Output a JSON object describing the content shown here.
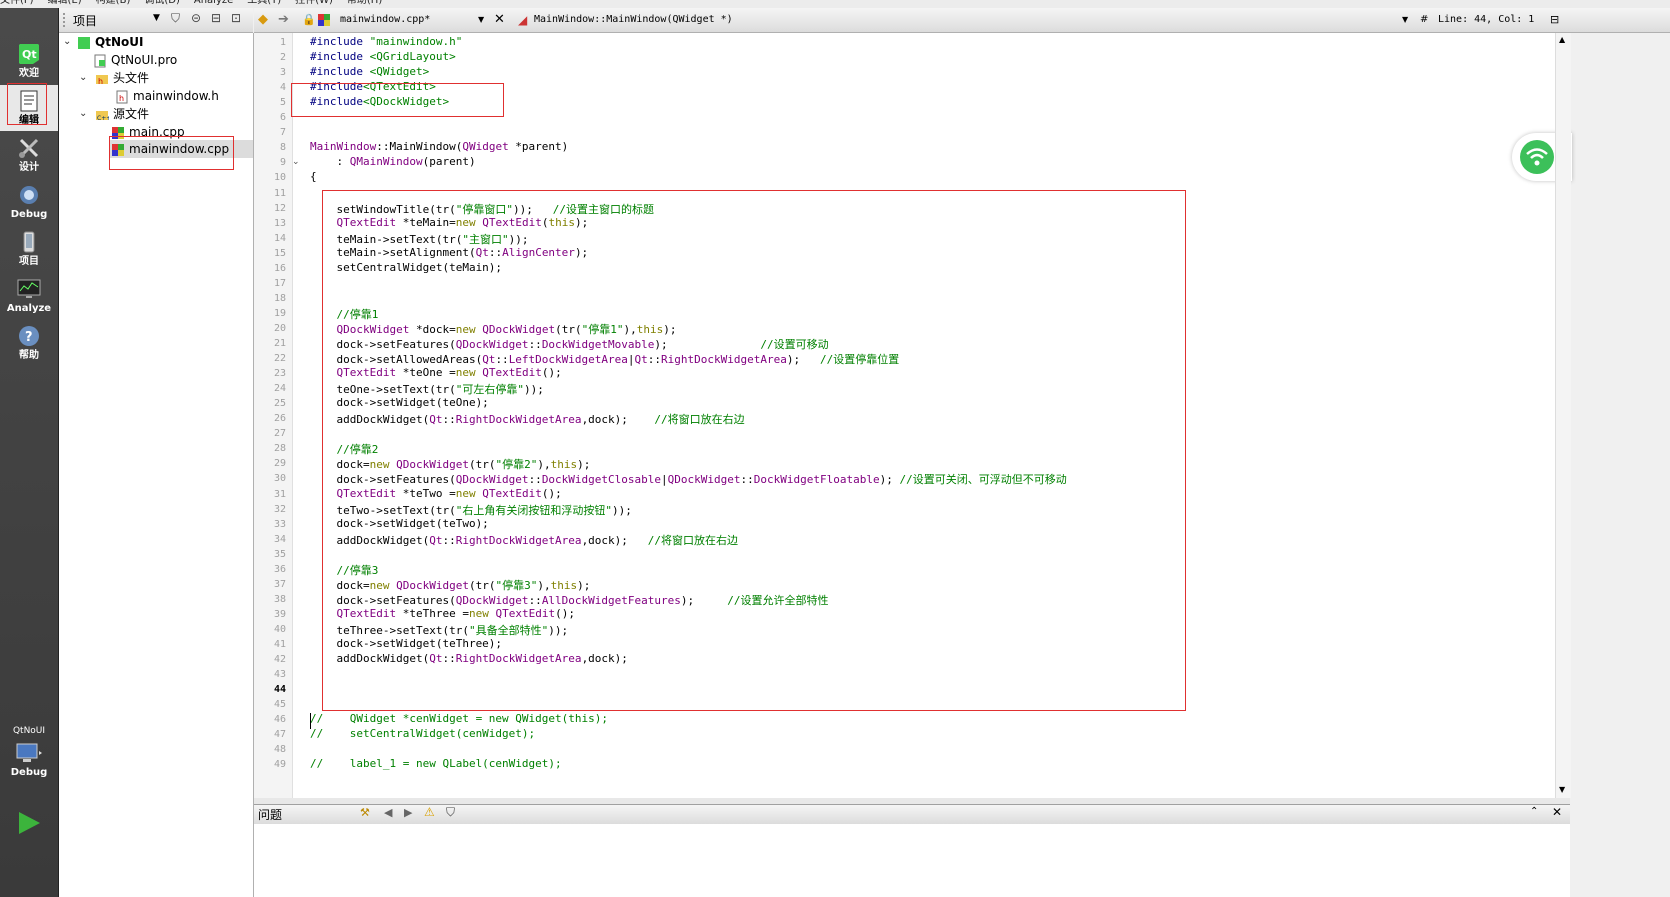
{
  "menu": [
    "文件(F)",
    "编辑(E)",
    "构建(B)",
    "调试(D)",
    "Analyze",
    "工具(T)",
    "控件(W)",
    "帮助(H)"
  ],
  "modes": [
    {
      "label": "欢迎",
      "icon": "qt-logo-icon"
    },
    {
      "label": "编辑",
      "icon": "edit-document-icon"
    },
    {
      "label": "设计",
      "icon": "design-tools-icon"
    },
    {
      "label": "Debug",
      "icon": "debug-bug-icon"
    },
    {
      "label": "项目",
      "icon": "project-wrench-icon"
    },
    {
      "label": "Analyze",
      "icon": "analyze-monitor-icon"
    },
    {
      "label": "帮助",
      "icon": "help-question-icon"
    }
  ],
  "kit": {
    "project": "QtNoUI",
    "config": "Debug"
  },
  "project_panel": {
    "title": "项目",
    "tree": [
      {
        "label": "QtNoUI",
        "bold": true,
        "icon": "qt-project-icon"
      },
      {
        "label": "QtNoUI.pro",
        "icon": "qt-pro-file-icon"
      },
      {
        "label": "头文件",
        "icon": "header-folder-icon"
      },
      {
        "label": "mainwindow.h",
        "icon": "header-file-icon"
      },
      {
        "label": "源文件",
        "icon": "source-folder-icon"
      },
      {
        "label": "main.cpp",
        "icon": "cpp-file-icon"
      },
      {
        "label": "mainwindow.cpp",
        "icon": "cpp-file-icon"
      }
    ]
  },
  "editor": {
    "file_tab": "mainwindow.cpp*",
    "function": "MainWindow::MainWindow(QWidget *)",
    "cursor": "Line: 44, Col: 1",
    "hash": "#",
    "current_line": "44",
    "lines": [
      [
        [
          "pp",
          "#include "
        ],
        [
          "str",
          "\"mainwindow.h\""
        ]
      ],
      [
        [
          "pp",
          "#include "
        ],
        [
          "str",
          "<QGridLayout>"
        ]
      ],
      [
        [
          "pp",
          "#include "
        ],
        [
          "str",
          "<QWidget>"
        ]
      ],
      [
        [
          "pp",
          "#include"
        ],
        [
          "str",
          "<QTextEdit>"
        ]
      ],
      [
        [
          "pp",
          "#include"
        ],
        [
          "str",
          "<QDockWidget>"
        ]
      ],
      [],
      [],
      [
        [
          "ty",
          "MainWindow"
        ],
        [
          "",
          "::MainWindow("
        ],
        [
          "ty",
          "QWidget"
        ],
        [
          "",
          " *parent)"
        ]
      ],
      [
        [
          "",
          "    : "
        ],
        [
          "ty",
          "QMainWindow"
        ],
        [
          "",
          "(parent)"
        ]
      ],
      [
        [
          "",
          "{"
        ]
      ],
      [],
      [
        [
          "",
          "    setWindowTitle(tr("
        ],
        [
          "str",
          "\"停靠窗口\""
        ],
        [
          "",
          "));   "
        ],
        [
          "cm",
          "//设置主窗口的标题"
        ]
      ],
      [
        [
          "",
          "    "
        ],
        [
          "ty",
          "QTextEdit"
        ],
        [
          "",
          " *teMain="
        ],
        [
          "kw",
          "new"
        ],
        [
          "",
          " "
        ],
        [
          "ty",
          "QTextEdit"
        ],
        [
          "",
          "("
        ],
        [
          "kw",
          "this"
        ],
        [
          "",
          ");"
        ]
      ],
      [
        [
          "",
          "    teMain->setText(tr("
        ],
        [
          "str",
          "\"主窗口\""
        ],
        [
          "",
          "));"
        ]
      ],
      [
        [
          "",
          "    teMain->setAlignment("
        ],
        [
          "ty",
          "Qt"
        ],
        [
          "",
          "::"
        ],
        [
          "ty",
          "AlignCenter"
        ],
        [
          "",
          ");"
        ]
      ],
      [
        [
          "",
          "    setCentralWidget(teMain);"
        ]
      ],
      [],
      [],
      [
        [
          "",
          "    "
        ],
        [
          "cm",
          "//停靠1"
        ]
      ],
      [
        [
          "",
          "    "
        ],
        [
          "ty",
          "QDockWidget"
        ],
        [
          "",
          " *dock="
        ],
        [
          "kw",
          "new"
        ],
        [
          "",
          " "
        ],
        [
          "ty",
          "QDockWidget"
        ],
        [
          "",
          "(tr("
        ],
        [
          "str",
          "\"停靠1\""
        ],
        [
          "",
          "),"
        ],
        [
          "kw",
          "this"
        ],
        [
          "",
          ");"
        ]
      ],
      [
        [
          "",
          "    dock->setFeatures("
        ],
        [
          "ty",
          "QDockWidget"
        ],
        [
          "",
          "::"
        ],
        [
          "ty",
          "DockWidgetMovable"
        ],
        [
          "",
          ");              "
        ],
        [
          "cm",
          "//设置可移动"
        ]
      ],
      [
        [
          "",
          "    dock->setAllowedAreas("
        ],
        [
          "ty",
          "Qt"
        ],
        [
          "",
          "::"
        ],
        [
          "ty",
          "LeftDockWidgetArea"
        ],
        [
          "",
          "|"
        ],
        [
          "ty",
          "Qt"
        ],
        [
          "",
          "::"
        ],
        [
          "ty",
          "RightDockWidgetArea"
        ],
        [
          "",
          ");   "
        ],
        [
          "cm",
          "//设置停靠位置"
        ]
      ],
      [
        [
          "",
          "    "
        ],
        [
          "ty",
          "QTextEdit"
        ],
        [
          "",
          " *teOne ="
        ],
        [
          "kw",
          "new"
        ],
        [
          "",
          " "
        ],
        [
          "ty",
          "QTextEdit"
        ],
        [
          "",
          "();"
        ]
      ],
      [
        [
          "",
          "    teOne->setText(tr("
        ],
        [
          "str",
          "\"可左右停靠\""
        ],
        [
          "",
          "));"
        ]
      ],
      [
        [
          "",
          "    dock->setWidget(teOne);"
        ]
      ],
      [
        [
          "",
          "    addDockWidget("
        ],
        [
          "ty",
          "Qt"
        ],
        [
          "",
          "::"
        ],
        [
          "ty",
          "RightDockWidgetArea"
        ],
        [
          "",
          ",dock);    "
        ],
        [
          "cm",
          "//将窗口放在右边"
        ]
      ],
      [],
      [
        [
          "",
          "    "
        ],
        [
          "cm",
          "//停靠2"
        ]
      ],
      [
        [
          "",
          "    dock="
        ],
        [
          "kw",
          "new"
        ],
        [
          "",
          " "
        ],
        [
          "ty",
          "QDockWidget"
        ],
        [
          "",
          "(tr("
        ],
        [
          "str",
          "\"停靠2\""
        ],
        [
          "",
          "),"
        ],
        [
          "kw",
          "this"
        ],
        [
          "",
          ");"
        ]
      ],
      [
        [
          "",
          "    dock->setFeatures("
        ],
        [
          "ty",
          "QDockWidget"
        ],
        [
          "",
          "::"
        ],
        [
          "ty",
          "DockWidgetClosable"
        ],
        [
          "",
          "|"
        ],
        [
          "ty",
          "QDockWidget"
        ],
        [
          "",
          "::"
        ],
        [
          "ty",
          "DockWidgetFloatable"
        ],
        [
          "",
          "); "
        ],
        [
          "cm",
          "//设置可关闭、可浮动但不可移动"
        ]
      ],
      [
        [
          "",
          "    "
        ],
        [
          "ty",
          "QTextEdit"
        ],
        [
          "",
          " *teTwo ="
        ],
        [
          "kw",
          "new"
        ],
        [
          "",
          " "
        ],
        [
          "ty",
          "QTextEdit"
        ],
        [
          "",
          "();"
        ]
      ],
      [
        [
          "",
          "    teTwo->setText(tr("
        ],
        [
          "str",
          "\"右上角有关闭按钮和浮动按钮\""
        ],
        [
          "",
          "));"
        ]
      ],
      [
        [
          "",
          "    dock->setWidget(teTwo);"
        ]
      ],
      [
        [
          "",
          "    addDockWidget("
        ],
        [
          "ty",
          "Qt"
        ],
        [
          "",
          "::"
        ],
        [
          "ty",
          "RightDockWidgetArea"
        ],
        [
          "",
          ",dock);   "
        ],
        [
          "cm",
          "//将窗口放在右边"
        ]
      ],
      [],
      [
        [
          "",
          "    "
        ],
        [
          "cm",
          "//停靠3"
        ]
      ],
      [
        [
          "",
          "    dock="
        ],
        [
          "kw",
          "new"
        ],
        [
          "",
          " "
        ],
        [
          "ty",
          "QDockWidget"
        ],
        [
          "",
          "(tr("
        ],
        [
          "str",
          "\"停靠3\""
        ],
        [
          "",
          "),"
        ],
        [
          "kw",
          "this"
        ],
        [
          "",
          ");"
        ]
      ],
      [
        [
          "",
          "    dock->setFeatures("
        ],
        [
          "ty",
          "QDockWidget"
        ],
        [
          "",
          "::"
        ],
        [
          "ty",
          "AllDockWidgetFeatures"
        ],
        [
          "",
          ");     "
        ],
        [
          "cm",
          "//设置允许全部特性"
        ]
      ],
      [
        [
          "",
          "    "
        ],
        [
          "ty",
          "QTextEdit"
        ],
        [
          "",
          " *teThree ="
        ],
        [
          "kw",
          "new"
        ],
        [
          "",
          " "
        ],
        [
          "ty",
          "QTextEdit"
        ],
        [
          "",
          "();"
        ]
      ],
      [
        [
          "",
          "    teThree->setText(tr("
        ],
        [
          "str",
          "\"具备全部特性\""
        ],
        [
          "",
          "));"
        ]
      ],
      [
        [
          "",
          "    dock->setWidget(teThree);"
        ]
      ],
      [
        [
          "",
          "    addDockWidget("
        ],
        [
          "ty",
          "Qt"
        ],
        [
          "",
          "::"
        ],
        [
          "ty",
          "RightDockWidgetArea"
        ],
        [
          "",
          ",dock);"
        ]
      ],
      [],
      [],
      [],
      [
        [
          "cm",
          "//    QWidget *cenWidget = new QWidget(this);"
        ]
      ],
      [
        [
          "cm",
          "//    setCentralWidget(cenWidget);"
        ]
      ],
      [],
      [
        [
          "cm",
          "//    label_1 = new QLabel(cenWidget);"
        ]
      ]
    ]
  },
  "output_panel": {
    "title": "问题"
  },
  "colors": {
    "highlight_box": "#e03030",
    "sidebar_bg": "#404040",
    "wifi_green": "#3cc05a"
  }
}
